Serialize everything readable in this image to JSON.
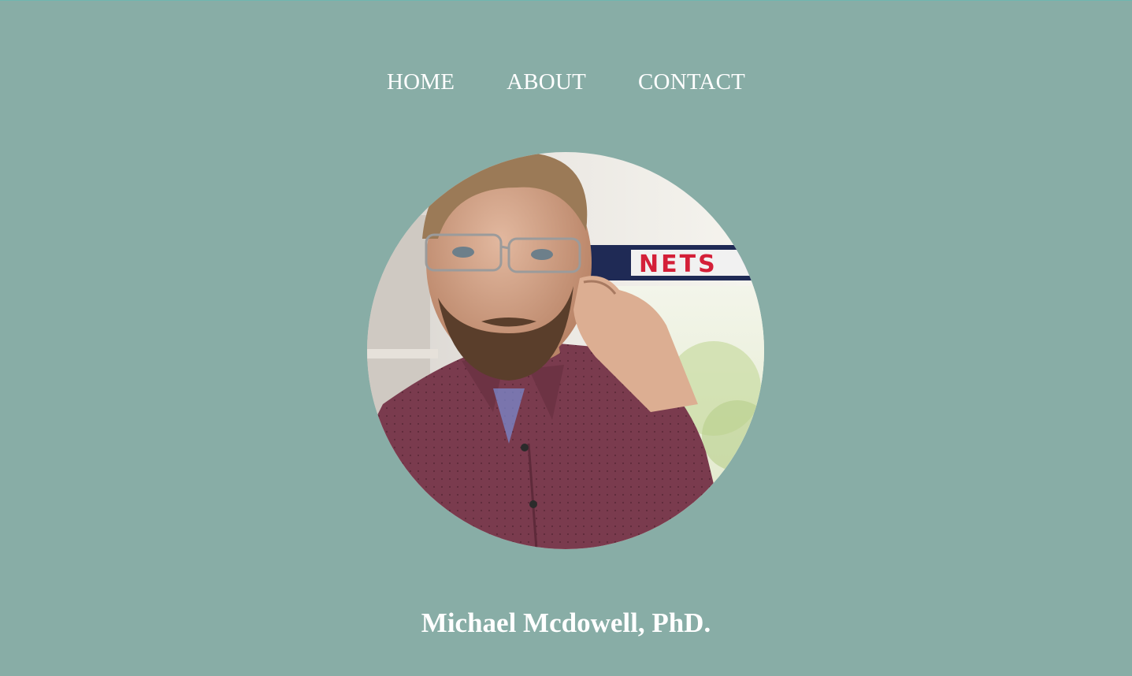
{
  "nav": {
    "items": [
      {
        "label": "HOME"
      },
      {
        "label": "ABOUT"
      },
      {
        "label": "CONTACT"
      }
    ]
  },
  "profile": {
    "name": "Michael Mcdowell, PhD.",
    "photo_icon": "profile-photo",
    "banner_text": "NETS"
  },
  "colors": {
    "background": "#88ada6",
    "text": "#ffffff",
    "shirt": "#7a3b4e"
  }
}
